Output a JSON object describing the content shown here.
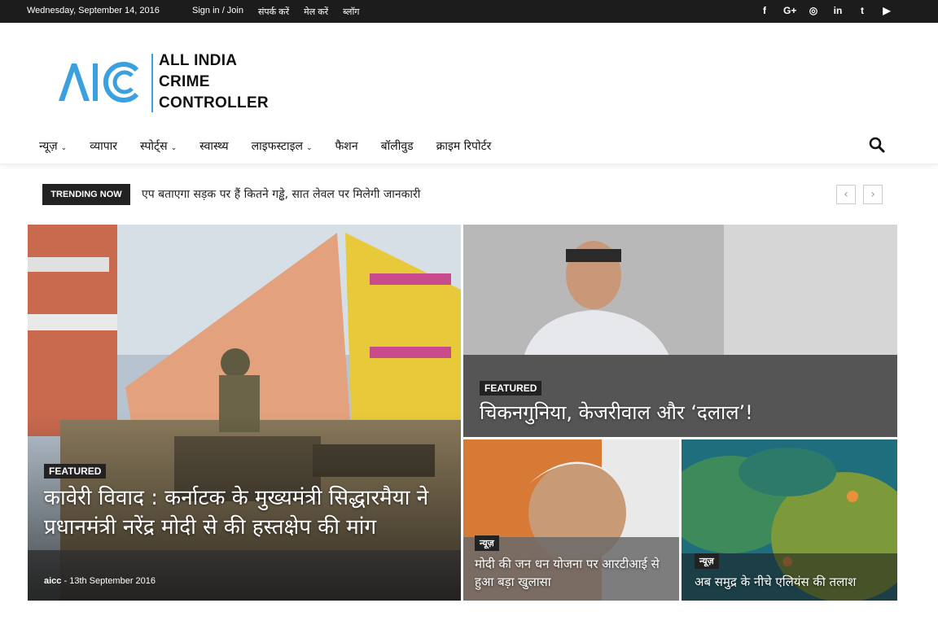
{
  "topbar": {
    "date": "Wednesday, September 14, 2016",
    "links": [
      "Sign in / Join",
      "संपर्क करें",
      "मेल करें",
      "ब्लॉग"
    ],
    "social_icons": [
      "facebook-icon",
      "google-plus-icon",
      "instagram-icon",
      "linkedin-icon",
      "twitter-icon",
      "youtube-icon"
    ],
    "social_glyphs": [
      "f",
      "G+",
      "◎",
      "in",
      "t",
      "▶"
    ]
  },
  "logo": {
    "mark": "AICC",
    "line1": "ALL INDIA",
    "line2": "CRIME",
    "line3": "CONTROLLER",
    "accent_color": "#3aa0e0"
  },
  "nav": {
    "items": [
      {
        "label": "न्यूज़",
        "dropdown": true
      },
      {
        "label": "व्यापार",
        "dropdown": false
      },
      {
        "label": "स्पोर्ट्स",
        "dropdown": true
      },
      {
        "label": "स्वास्थ्य",
        "dropdown": false
      },
      {
        "label": "लाइफस्टाइल",
        "dropdown": true
      },
      {
        "label": "फैशन",
        "dropdown": false
      },
      {
        "label": "बॉलीवुड",
        "dropdown": false
      },
      {
        "label": "क्राइम रिपोर्टर",
        "dropdown": false
      }
    ],
    "chevron": "⌄",
    "search_icon": "search-icon"
  },
  "trending": {
    "label": "TRENDING NOW",
    "headline": "एप बताएगा सड़क पर हैं कितने गड्ढे, सात लेवल पर मिलेगी जानकारी",
    "prev": "‹",
    "next": "›"
  },
  "articles": [
    {
      "tag": "FEATURED",
      "title": "कावेरी विवाद : कर्नाटक के मुख्यमंत्री सिद्धारमैया ने प्रधानमंत्री नरेंद्र मोदी से की हस्तक्षेप की मांग",
      "author": "aicc",
      "sep": "-",
      "date": "13th September 2016"
    },
    {
      "tag": "FEATURED",
      "title": "चिकनगुनिया, केजरीवाल और ‘दलाल’!"
    },
    {
      "tag": "न्यूज़",
      "title": "मोदी की जन धन योजना पर आरटीआई से हुआ बड़ा खुलासा"
    },
    {
      "tag": "न्यूज़",
      "title": "अब समुद्र के नीचे एलियंस की तलाश"
    }
  ]
}
